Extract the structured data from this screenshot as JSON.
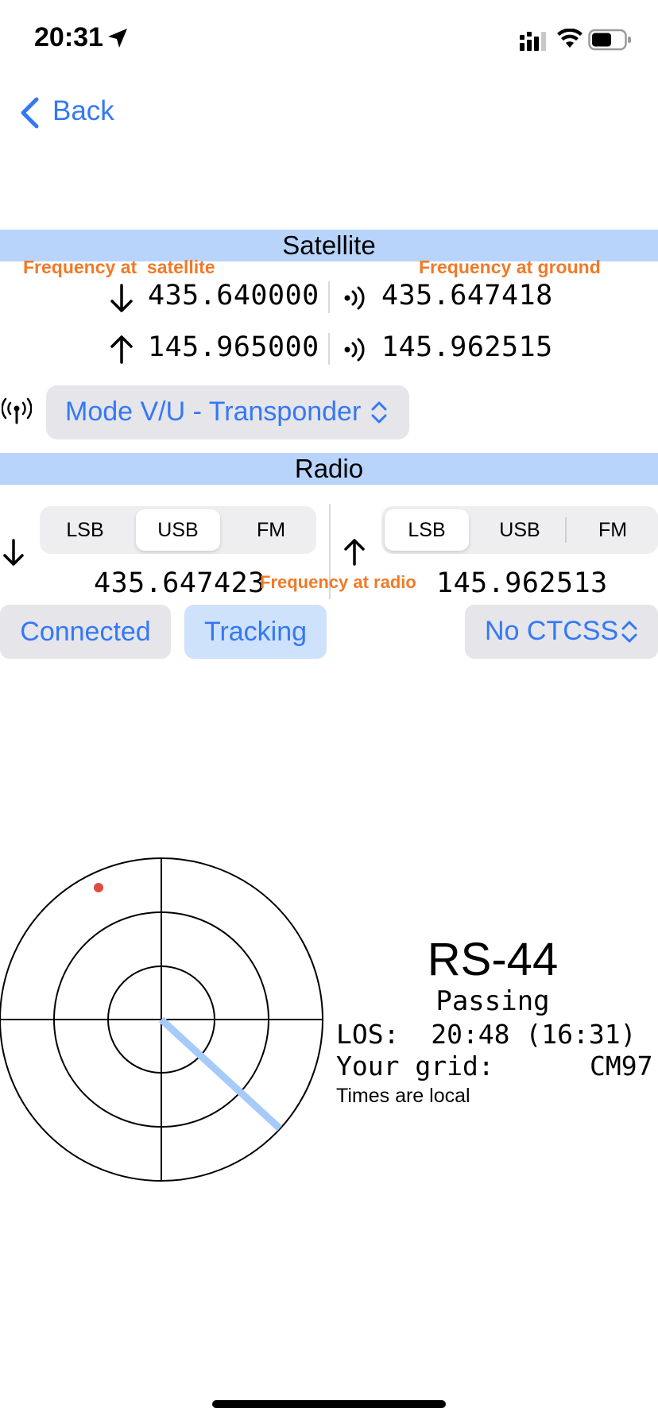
{
  "status_bar": {
    "time": "20:31"
  },
  "nav": {
    "back_label": "Back"
  },
  "satellite_section": {
    "title": "Satellite",
    "annot_satellite": "Frequency at  satellite",
    "annot_ground": "Frequency at ground",
    "downlink_sat": "435.640000",
    "downlink_ground": "435.647418",
    "uplink_sat": "145.965000",
    "uplink_ground": "145.962515",
    "mode_label": "Mode V/U - Transponder"
  },
  "radio_section": {
    "title": "Radio",
    "down_modes": [
      "LSB",
      "USB",
      "FM"
    ],
    "down_selected": "USB",
    "up_modes": [
      "LSB",
      "USB",
      "FM"
    ],
    "up_selected": "LSB",
    "down_freq": "435.647423",
    "annot_radio": "Frequency at radio",
    "up_freq": "145.962513"
  },
  "controls": {
    "connected_label": "Connected",
    "tracking_label": "Tracking",
    "ctcss_label": "No CTCSS"
  },
  "pass_info": {
    "satellite_name": "RS-44",
    "state": "Passing",
    "los_line": "LOS:  20:48 (16:31)",
    "grid_label": "Your grid:",
    "grid_value": "CM97",
    "note": "Times are local"
  },
  "colors": {
    "accent": "#3478F6",
    "band": "#B8D4FB",
    "annotation": "#F07A28",
    "sat_dot": "#E04B3F",
    "track": "#A6CBF9"
  }
}
